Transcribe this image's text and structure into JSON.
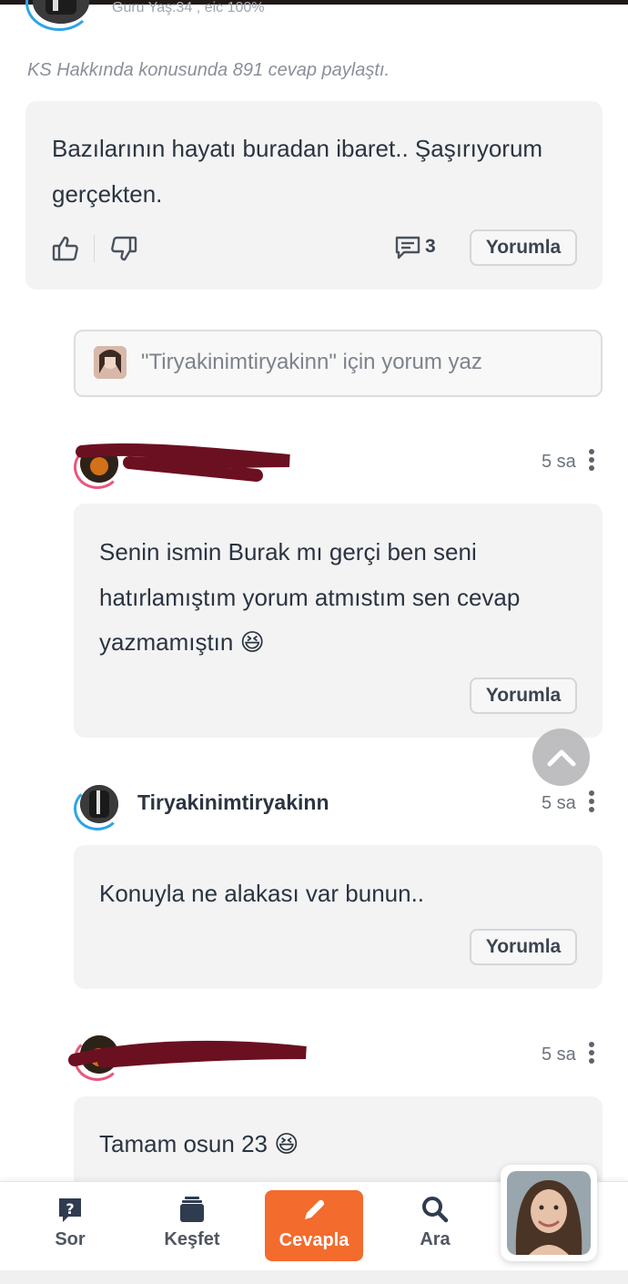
{
  "header": {
    "user_meta": "Guru Yaş:34 , eic 100%"
  },
  "activity": "KS Hakkında konusunda 891 cevap paylaştı.",
  "answer": {
    "text_line1": "Bazılarının hayatı buradan ibaret.. Şaşırıyorum",
    "text_line2": "gerçekten.",
    "comment_count": "3",
    "comment_button": "Yorumla"
  },
  "reply_input": {
    "placeholder": "\"Tiryakinimtiryakinn\" için yorum yaz"
  },
  "comments": [
    {
      "time": "5 sa",
      "line1": "Senin ismin Burak mı gerçi ben seni",
      "line2": "hatırlamıştım yorum atmıstım sen cevap",
      "line3": "yazmamıştın 😆",
      "button": "Yorumla"
    },
    {
      "username": "Tiryakinimtiryakinn",
      "time": "5 sa",
      "line1": "Konuyla ne alakası var bunun..",
      "button": "Yorumla"
    },
    {
      "time": "5 sa",
      "line1": "Tamam osun 23 😆"
    }
  ],
  "nav": {
    "items": [
      {
        "label": "Sor",
        "icon": "question-icon"
      },
      {
        "label": "Keşfet",
        "icon": "stack-icon"
      },
      {
        "label": "Cevapla",
        "icon": "pencil-icon"
      },
      {
        "label": "Ara",
        "icon": "search-icon"
      }
    ]
  },
  "colors": {
    "accent": "#f36b2d",
    "ring_blue": "#2ea4e6",
    "ring_pink": "#e8577d",
    "redaction": "#6b1020"
  }
}
